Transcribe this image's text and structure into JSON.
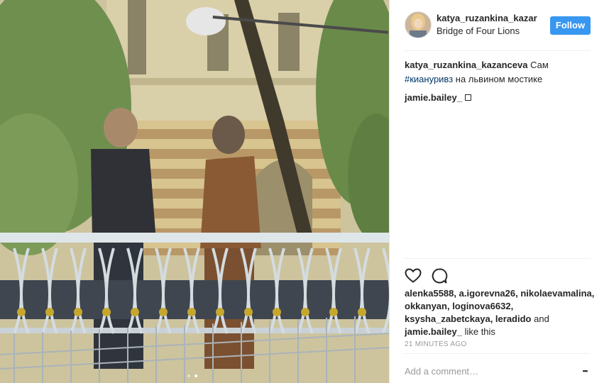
{
  "post": {
    "username": "katya_ruzankina_kazar",
    "location": "Bridge of Four Lions",
    "follow_label": "Follow",
    "caption": {
      "user": "katya_ruzankina_kazanceva",
      "text_before": "Сам",
      "hashtag": "#киануривз",
      "text_after": "на львином мостике"
    },
    "comments": [
      {
        "user": "jamie.bailey_",
        "text": ""
      }
    ],
    "likes": {
      "names_line": "alenka5588, a.igorevna26, nikolaevamalina, okkanyan, loginova6632, ksysha_zabetckaya, leradido",
      "connector": "and",
      "last_name": "jamie.bailey_",
      "suffix": "like this"
    },
    "timestamp": "21 MINUTES AGO",
    "add_comment_placeholder": "Add a comment…",
    "more_glyph": "•••"
  },
  "carousel": {
    "count": 2,
    "active": 1
  },
  "colors": {
    "follow_bg": "#3897f0",
    "hashtag": "#003569",
    "meta": "#999999"
  },
  "icons": [
    "heart-icon",
    "comment-icon",
    "more-options-icon"
  ]
}
